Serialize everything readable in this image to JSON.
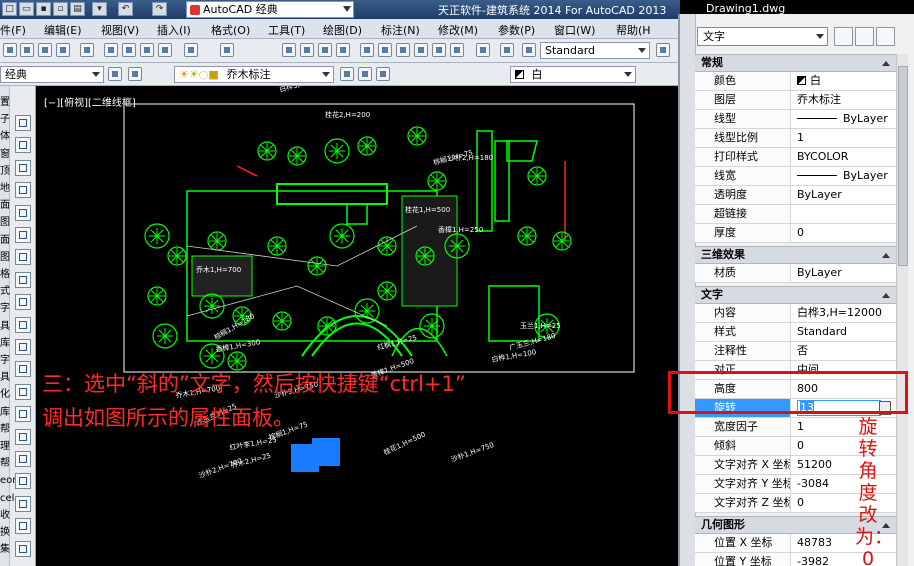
{
  "title_bar": {
    "workspace": "AutoCAD 经典",
    "app_title": "天正软件-建筑系统 2014  For AutoCAD 2013",
    "document": "Drawing1.dwg"
  },
  "menu": [
    "件(F)",
    "编辑(E)",
    "视图(V)",
    "插入(I)",
    "格式(O)",
    "工具(T)",
    "绘图(D)",
    "标注(N)",
    "修改(M)",
    "参数(P)",
    "窗口(W)",
    "帮助(H"
  ],
  "toolbar2": {
    "text_style": "Standard"
  },
  "toolbar3": {
    "workspace_combo": "经典",
    "layer_combo": "乔木标注",
    "color_combo": "白"
  },
  "left_chars": [
    "置",
    "子",
    "体",
    "窗",
    "顶",
    "地",
    "面",
    "图",
    "面",
    "图",
    "格",
    "式",
    "字",
    "具",
    "库",
    "字",
    "具",
    "化",
    "库",
    "帮",
    "理",
    "帮",
    "eor",
    "cel",
    "收",
    "换",
    "集"
  ],
  "viewport_label": "[−][俯视][二维线框]",
  "drawing": {
    "labels": [
      "沙朴1,H=750",
      "乔木1,H=700",
      "广玉兰,H=250",
      "桂花1,H=500",
      "白桦3,H=12000",
      "红叶李1,H=15",
      "沙朴2,H=180",
      "桂花2,H=200",
      "棕榈1,H=75",
      "桂花1,H=500",
      "乔木1,H=700",
      "香樟1,H=250",
      "棕榈1,H=180",
      "香樟1,H=300",
      "红枫1,H=25",
      "玉兰1,H=25",
      "广玉兰,H=180",
      "白桦1,H=100",
      "香樟1,H=500",
      "沙朴3,H=750",
      "乔木1,H=700",
      "棕榈1,H=75",
      "广玉兰,H=25",
      "红叶李1,H=25",
      "桂花1,H=500",
      "沙朴1,H=750",
      "乔木2,H=25",
      "沙朴2,H=700"
    ]
  },
  "instruction": {
    "line1": "三：选中“斜的”文字，然后按快捷键“ctrl+1”",
    "line2": "调出如图所示的属性面板。"
  },
  "annotation_vertical": "旋转角度改为：0",
  "properties": {
    "object_type": "文字",
    "sections": [
      {
        "title": "常规",
        "rows": [
          {
            "label": "颜色",
            "value": "白"
          },
          {
            "label": "图层",
            "value": "乔木标注"
          },
          {
            "label": "线型",
            "value": "ByLayer"
          },
          {
            "label": "线型比例",
            "value": "1"
          },
          {
            "label": "打印样式",
            "value": "BYCOLOR"
          },
          {
            "label": "线宽",
            "value": "ByLayer"
          },
          {
            "label": "透明度",
            "value": "ByLayer"
          },
          {
            "label": "超链接",
            "value": ""
          },
          {
            "label": "厚度",
            "value": "0"
          }
        ]
      },
      {
        "title": "三维效果",
        "rows": [
          {
            "label": "材质",
            "value": "ByLayer"
          }
        ]
      },
      {
        "title": "文字",
        "rows": [
          {
            "label": "内容",
            "value": "白桦3,H=12000"
          },
          {
            "label": "样式",
            "value": "Standard"
          },
          {
            "label": "注释性",
            "value": "否"
          },
          {
            "label": "对正",
            "value": "中间"
          },
          {
            "label": "高度",
            "value": "800"
          },
          {
            "label": "旋转",
            "value": "13"
          },
          {
            "label": "宽度因子",
            "value": "1"
          },
          {
            "label": "倾斜",
            "value": "0"
          },
          {
            "label": "文字对齐 X 坐标",
            "value": "51200"
          },
          {
            "label": "文字对齐 Y 坐标",
            "value": "-3084"
          },
          {
            "label": "文字对齐 Z 坐标",
            "value": "0"
          }
        ]
      },
      {
        "title": "几何图形",
        "rows": [
          {
            "label": "位置 X 坐标",
            "value": "48783"
          },
          {
            "label": "位置 Y 坐标",
            "value": "-3982"
          }
        ]
      }
    ]
  },
  "colors": {
    "accent_red": "#e01010",
    "selection": "#3399ff",
    "cad_green": "#00ff00",
    "drawing_bg": "#000000"
  }
}
